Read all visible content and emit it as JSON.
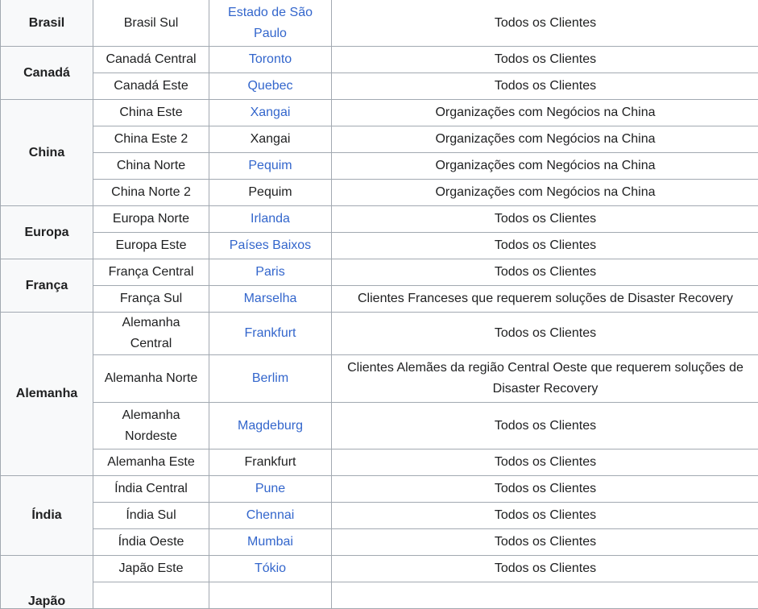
{
  "rows": {
    "brasil": {
      "country": "Brasil",
      "region": "Brasil Sul",
      "location": "Estado de São Paulo",
      "availability": "Todos os Clientes"
    },
    "canada_1": {
      "country": "Canadá",
      "region": "Canadá Central",
      "location": "Toronto",
      "availability": "Todos os Clientes"
    },
    "canada_2": {
      "region": "Canadá Este",
      "location": "Quebec",
      "availability": "Todos os Clientes"
    },
    "china_1": {
      "country": "China",
      "region": "China Este",
      "location": "Xangai",
      "availability": "Organizações com Negócios na China"
    },
    "china_2": {
      "region": "China Este 2",
      "location": "Xangai",
      "availability": "Organizações com Negócios na China"
    },
    "china_3": {
      "region": "China Norte",
      "location": "Pequim",
      "availability": "Organizações com Negócios na China"
    },
    "china_4": {
      "region": "China Norte 2",
      "location": "Pequim",
      "availability": "Organizações com Negócios na China"
    },
    "europa_1": {
      "country": "Europa",
      "region": "Europa Norte",
      "location": "Irlanda",
      "availability": "Todos os Clientes"
    },
    "europa_2": {
      "region": "Europa Este",
      "location": "Países Baixos",
      "availability": "Todos os Clientes"
    },
    "franca_1": {
      "country": "França",
      "region": "França Central",
      "location": "Paris",
      "availability": "Todos os Clientes"
    },
    "franca_2": {
      "region": "França Sul",
      "location": "Marselha",
      "availability": "Clientes Franceses que requerem soluções de Disaster Recovery"
    },
    "alemanha_1": {
      "country": "Alemanha",
      "region": "Alemanha Central",
      "location": "Frankfurt",
      "availability": "Todos os Clientes"
    },
    "alemanha_2": {
      "region": "Alemanha Norte",
      "location": "Berlim",
      "availability": "Clientes Alemães da região Central Oeste que requerem soluções de Disaster Recovery"
    },
    "alemanha_3": {
      "region": "Alemanha Nordeste",
      "location": "Magdeburg",
      "availability": "Todos os Clientes"
    },
    "alemanha_4": {
      "region": "Alemanha Este",
      "location": "Frankfurt",
      "availability": "Todos os Clientes"
    },
    "india_1": {
      "country": "Índia",
      "region": "Índia Central",
      "location": "Pune",
      "availability": "Todos os Clientes"
    },
    "india_2": {
      "region": "Índia Sul",
      "location": "Chennai",
      "availability": "Todos os Clientes"
    },
    "india_3": {
      "region": "Índia Oeste",
      "location": "Mumbai",
      "availability": "Todos os Clientes"
    },
    "japao_1": {
      "country": "Japão",
      "region": "Japão Este",
      "location": "Tókio",
      "availability": "Todos os Clientes"
    }
  },
  "colors": {
    "link": "#3366cc",
    "text": "#202122",
    "border": "#a2a9b1",
    "header_bg": "#f8f9fa"
  }
}
